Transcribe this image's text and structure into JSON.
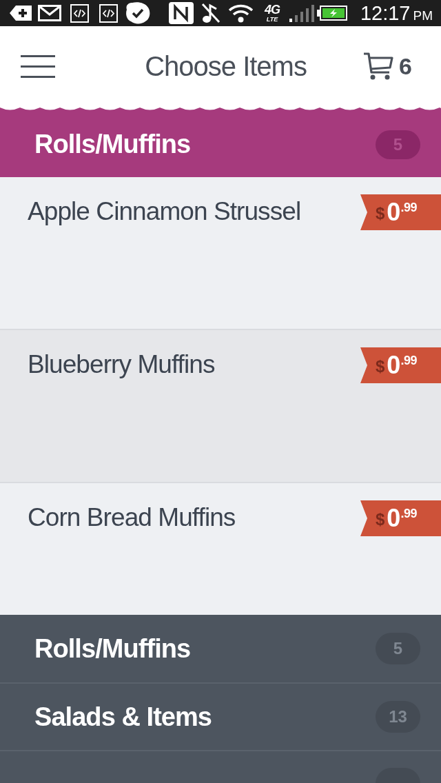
{
  "status_bar": {
    "network": "4G",
    "network_sub": "LTE",
    "time": "12:17",
    "time_suffix": "PM"
  },
  "header": {
    "title": "Choose Items",
    "cart_count": "6"
  },
  "category": {
    "name": "Rolls/Muffins",
    "count": "5"
  },
  "items": [
    {
      "name": "Apple Cinnamon Strussel",
      "price": {
        "currency": "$",
        "whole": "0",
        "cents": ".99"
      }
    },
    {
      "name": "Blueberry Muffins",
      "price": {
        "currency": "$",
        "whole": "0",
        "cents": ".99"
      }
    },
    {
      "name": "Corn Bread Muffins",
      "price": {
        "currency": "$",
        "whole": "0",
        "cents": ".99"
      }
    }
  ],
  "category_drawer": {
    "categories": [
      {
        "name": "Rolls/Muffins",
        "count": "5"
      },
      {
        "name": "Salads & Items",
        "count": "13"
      }
    ],
    "more_below": true
  }
}
